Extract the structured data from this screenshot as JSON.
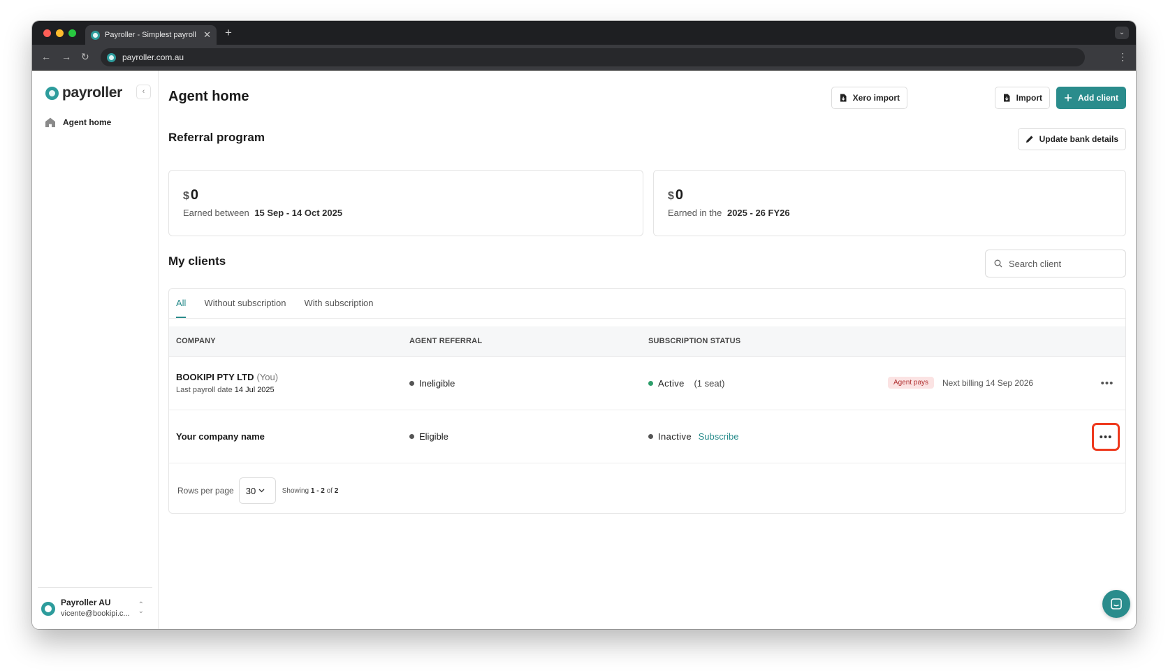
{
  "browser": {
    "tab_title": "Payroller - Simplest payroll software",
    "url": "payroller.com.au"
  },
  "sidebar": {
    "logo_text": "payroller",
    "nav_items": [
      {
        "label": "Agent home",
        "icon": "home-icon"
      }
    ],
    "account": {
      "name": "Payroller AU",
      "email": "vicente@bookipi.c..."
    }
  },
  "header": {
    "title": "Agent home",
    "buttons": {
      "xero_import": "Xero import",
      "import": "Import",
      "add_client": "Add client"
    }
  },
  "referral": {
    "title": "Referral program",
    "update_bank_label": "Update bank details",
    "cards": [
      {
        "currency": "$",
        "amount": "0",
        "prefix": "Earned between",
        "period": "15 Sep - 14 Oct  2025"
      },
      {
        "currency": "$",
        "amount": "0",
        "prefix": "Earned in the",
        "period": "2025 - 26  FY26"
      }
    ]
  },
  "clients": {
    "title": "My clients",
    "search_placeholder": "Search client",
    "tabs": [
      "All",
      "Without subscription",
      "With subscription"
    ],
    "active_tab": "All",
    "columns": [
      "COMPANY",
      "AGENT REFERRAL",
      "SUBSCRIPTION STATUS"
    ],
    "rows": [
      {
        "company": "BOOKIPI PTY LTD",
        "you_label": "(You)",
        "last_payroll_label": "Last payroll date",
        "last_payroll_date": "14 Jul 2025",
        "referral": "Ineligible",
        "status": "Active",
        "seats": "(1 seat)",
        "badge": "Agent pays",
        "next_billing": "Next billing 14 Sep 2026"
      },
      {
        "company": "Your company name",
        "referral": "Eligible",
        "status": "Inactive",
        "action": "Subscribe"
      }
    ],
    "pagination": {
      "rows_per_page_label": "Rows per page",
      "rows_per_page": "30",
      "showing_label": "Showing",
      "range": "1 - 2",
      "of_label": "of",
      "total": "2"
    }
  },
  "colors": {
    "brand": "#2a8c8c",
    "active_status": "#2e9e6b",
    "neutral_status": "#555555",
    "focus_ring": "#ee3a1e"
  }
}
